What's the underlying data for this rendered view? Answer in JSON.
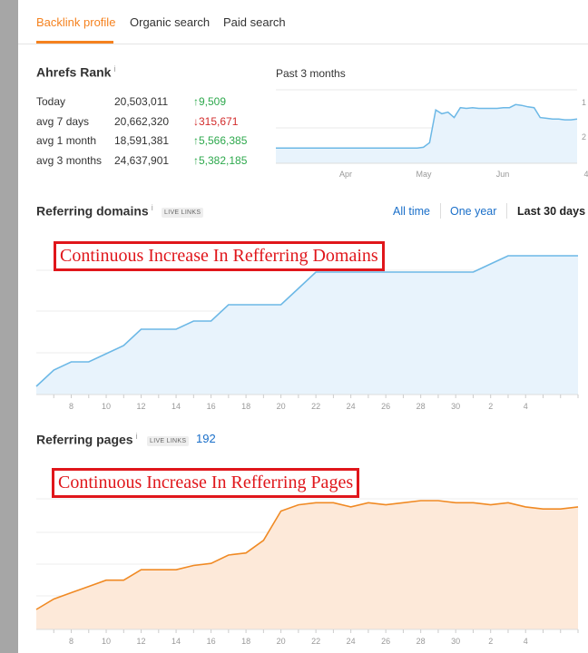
{
  "tabs": [
    {
      "label": "Backlink profile",
      "active": true
    },
    {
      "label": "Organic search",
      "active": false
    },
    {
      "label": "Paid search",
      "active": false
    }
  ],
  "ahrefs_rank": {
    "title": "Ahrefs Rank",
    "info": "i",
    "rows": [
      {
        "label": "Today",
        "value": "20,503,011",
        "change": "9,509",
        "direction": "up"
      },
      {
        "label": "avg 7 days",
        "value": "20,662,320",
        "change": "315,671",
        "direction": "down"
      },
      {
        "label": "avg 1 month",
        "value": "18,591,381",
        "change": "5,566,385",
        "direction": "up"
      },
      {
        "label": "avg 3 months",
        "value": "24,637,901",
        "change": "5,382,185",
        "direction": "up"
      }
    ],
    "up_arrow": "↑",
    "down_arrow": "↓"
  },
  "rank_chart": {
    "period_label": "Past 3 months",
    "x_labels": [
      "Apr",
      "May",
      "Jun",
      "4"
    ],
    "right_ticks": [
      "1",
      "2"
    ]
  },
  "referring_domains": {
    "title": "Referring domains",
    "info": "i",
    "badge": "LIVE LINKS",
    "filters": {
      "all_time": "All time",
      "one_year": "One year",
      "last_30": "Last 30 days"
    },
    "annotation": "Continuous Increase In Refferring Domains"
  },
  "referring_pages": {
    "title": "Referring pages",
    "info": "i",
    "badge": "LIVE LINKS",
    "count": "192",
    "annotation": "Continuous Increase In Refferring Pages"
  },
  "colors": {
    "accent": "#f5821f",
    "link": "#1a6fc9",
    "up": "#2da84c",
    "down": "#d22b2b",
    "blue_line": "#6cb8e6",
    "blue_fill": "#e8f3fc",
    "orange_line": "#f08a24",
    "orange_fill": "#fde9d9"
  },
  "chart_data": [
    {
      "type": "area",
      "id": "rank_chart",
      "x_labels": [
        "Apr",
        "May",
        "Jun",
        "4"
      ],
      "series": [
        {
          "values": [
            0.2,
            0.2,
            0.2,
            0.2,
            0.2,
            0.2,
            0.2,
            0.2,
            0.2,
            0.2,
            0.2,
            0.2,
            0.2,
            0.2,
            0.2,
            0.2,
            0.2,
            0.2,
            0.2,
            0.2,
            0.2,
            0.2,
            0.2,
            0.2,
            0.21,
            0.27,
            0.7,
            0.65,
            0.67,
            0.6,
            0.73,
            0.72,
            0.73,
            0.72,
            0.72,
            0.72,
            0.72,
            0.73,
            0.73,
            0.77,
            0.76,
            0.74,
            0.73,
            0.6,
            0.59,
            0.58,
            0.58,
            0.57,
            0.57,
            0.58
          ]
        }
      ]
    },
    {
      "type": "area",
      "id": "referring_domains",
      "x": [
        "6",
        "7",
        "8",
        "9",
        "10",
        "11",
        "12",
        "13",
        "14",
        "15",
        "16",
        "17",
        "18",
        "19",
        "20",
        "21",
        "22",
        "23",
        "24",
        "25",
        "26",
        "27",
        "28",
        "29",
        "30",
        "31",
        "1",
        "2",
        "3",
        "4",
        "5",
        "6"
      ],
      "x_tick_labels": [
        "8",
        "10",
        "12",
        "14",
        "16",
        "18",
        "20",
        "22",
        "24",
        "26",
        "28",
        "30",
        "2",
        "4"
      ],
      "series": [
        {
          "values": [
            0,
            2,
            3,
            3,
            4,
            5,
            7,
            7,
            7,
            8,
            8,
            10,
            10,
            10,
            10,
            12,
            14,
            14,
            14,
            14,
            14,
            14,
            14,
            14,
            14,
            14,
            15,
            16,
            16,
            16,
            16,
            16
          ]
        }
      ]
    },
    {
      "type": "area",
      "id": "referring_pages",
      "x": [
        "6",
        "7",
        "8",
        "9",
        "10",
        "11",
        "12",
        "13",
        "14",
        "15",
        "16",
        "17",
        "18",
        "19",
        "20",
        "21",
        "22",
        "23",
        "24",
        "25",
        "26",
        "27",
        "28",
        "29",
        "30",
        "31",
        "1",
        "2",
        "3",
        "4",
        "5",
        "6"
      ],
      "x_tick_labels": [
        "8",
        "10",
        "12",
        "14",
        "16",
        "18",
        "20",
        "22",
        "24",
        "26",
        "28",
        "30",
        "2",
        "4"
      ],
      "series": [
        {
          "values": [
            155,
            160,
            163,
            166,
            169,
            169,
            174,
            174,
            174,
            176,
            177,
            181,
            182,
            188,
            202,
            205,
            206,
            206,
            204,
            206,
            205,
            206,
            207,
            207,
            206,
            206,
            205,
            206,
            204,
            203,
            203,
            204
          ]
        }
      ]
    }
  ]
}
